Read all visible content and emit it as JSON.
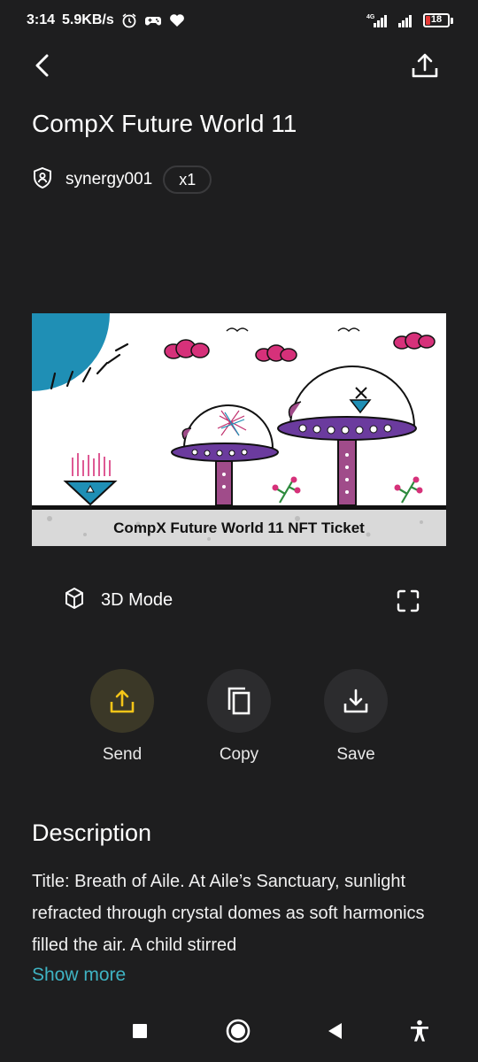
{
  "status_bar": {
    "time": "3:14",
    "net_speed": "5.9KB/s",
    "battery_level": "18",
    "battery_fraction": 0.18,
    "network_label": "4G",
    "icons": [
      "alarm-icon",
      "game-controller-icon",
      "heart-icon",
      "signal-4g-icon",
      "signal-icon",
      "battery-icon"
    ],
    "battery_color": "#e53935"
  },
  "header": {
    "back_icon": "chevron-left-icon",
    "share_icon": "upload-icon"
  },
  "nft": {
    "title": "CompX Future World 11",
    "owner_icon": "shield-user-icon",
    "owner": "synergy001",
    "quantity": "x1",
    "image_caption": "CompX Future World 11 NFT Ticket"
  },
  "view_mode": {
    "label": "3D Mode",
    "icon": "cube-icon",
    "fullscreen_icon": "fullscreen-icon"
  },
  "actions": [
    {
      "label": "Send",
      "icon": "send-upload-icon",
      "color": "#f5c518"
    },
    {
      "label": "Copy",
      "icon": "copy-icon",
      "color": "#ffffff"
    },
    {
      "label": "Save",
      "icon": "download-icon",
      "color": "#ffffff"
    }
  ],
  "description": {
    "heading": "Description",
    "text": "Title: Breath of Aile. At Aile’s Sanctuary, sunlight refracted through crystal domes as soft harmonics filled the air. A child stirred",
    "show_more": "Show more",
    "link_color": "#3fb3c3"
  },
  "nav_bar": {
    "icons": [
      "recents-square-icon",
      "home-circle-icon",
      "back-triangle-icon",
      "accessibility-icon"
    ]
  }
}
